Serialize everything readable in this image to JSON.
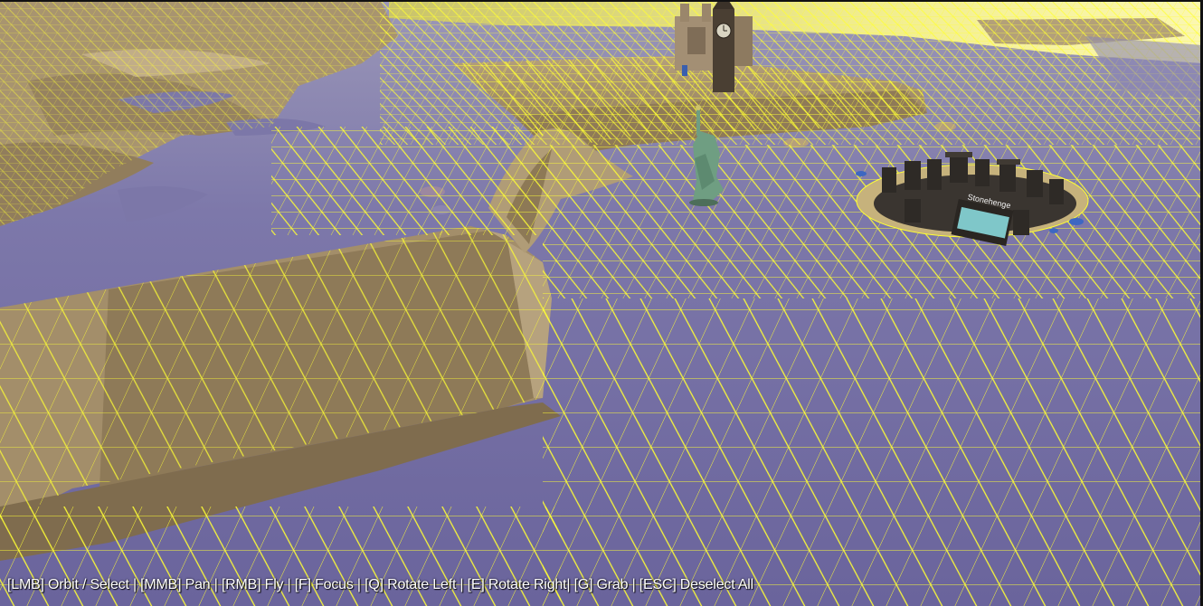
{
  "viewport": {
    "label": "3D scene viewport",
    "colors": {
      "water": "#6f6aa0",
      "water_light": "#8c87b5",
      "sand": "#a8946f",
      "sand_dark": "#7c6a4e",
      "wireframe": "#ffff33",
      "sky_glow": "#f3f08a"
    }
  },
  "scene_objects": {
    "landmark_left_tower": "cathedral-model",
    "landmark_clock_tower": "clock-tower-model",
    "landmark_statue": "statue-of-liberty-model",
    "landmark_stone_circle": "stonehenge-model",
    "stone_circle_sign": "Stonehenge"
  },
  "hint_bar": {
    "text": "[LMB] Orbit / Select | [MMB] Pan | [RMB] Fly | [F] Focus | [Q] Rotate Left | [E] Rotate Right| [G] Grab | [ESC] Deselect All"
  }
}
